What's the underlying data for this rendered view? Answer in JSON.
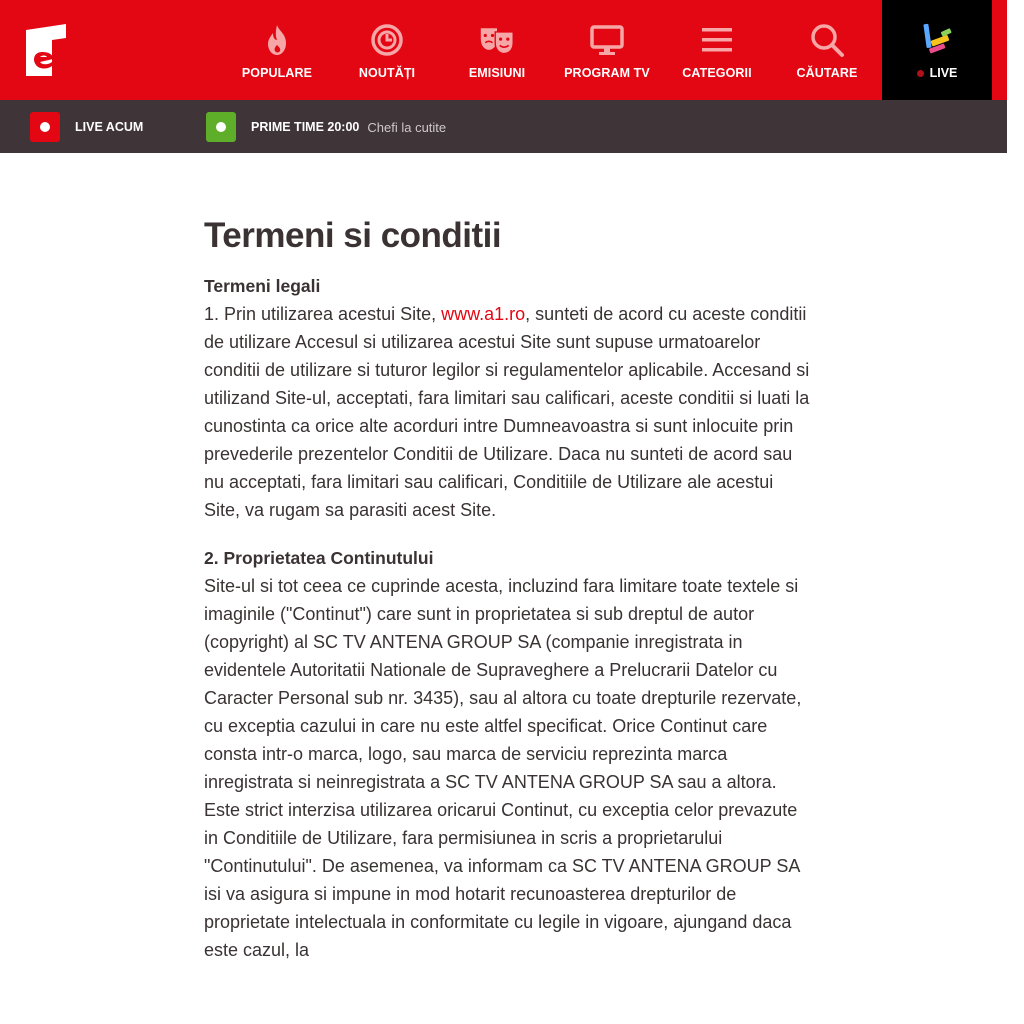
{
  "header": {
    "logo_label": "Antena 1 logo",
    "nav": [
      {
        "label": "POPULARE",
        "icon": "flame-icon"
      },
      {
        "label": "NOUTĂȚI",
        "icon": "clock-icon"
      },
      {
        "label": "EMISIUNI",
        "icon": "theater-masks-icon"
      },
      {
        "label": "PROGRAM TV",
        "icon": "tv-monitor-icon"
      },
      {
        "label": "CATEGORII",
        "icon": "menu-lines-icon"
      },
      {
        "label": "CĂUTARE",
        "icon": "search-icon"
      }
    ],
    "live_label": "LIVE",
    "live_icon": "antena-play-icon"
  },
  "subbar": {
    "live_now_label": "LIVE ACUM",
    "prime_time_label": "PRIME TIME 20:00",
    "prime_time_show": "Chefi la cutite"
  },
  "main": {
    "title": "Termeni si conditii",
    "section1_heading": "Termeni legali",
    "section1_text_before_link": "1. Prin utilizarea acestui Site, ",
    "section1_link": "www.a1.ro",
    "section1_text_after_link": ", sunteti de acord cu aceste conditii de utilizare Accesul si utilizarea acestui Site sunt supuse urmatoarelor conditii de utilizare si tuturor legilor si regulamentelor aplicabile. Accesand si utilizand Site-ul, acceptati, fara limitari sau calificari, aceste conditii si luati la cunostinta ca orice alte acorduri intre Dumneavoastra si sunt inlocuite prin prevederile prezentelor Conditii de Utilizare. Daca nu sunteti de acord sau nu acceptati, fara limitari sau calificari, Conditiile de Utilizare ale acestui Site, va rugam sa parasiti acest Site.",
    "section2_heading": "2. Proprietatea Continutului",
    "section2_text": "Site-ul si tot ceea ce cuprinde acesta, incluzind fara limitare toate textele si imaginile (\"Continut\") care sunt in proprietatea si sub dreptul de autor (copyright) al SC TV ANTENA GROUP SA (companie inregistrata in evidentele Autoritatii Nationale de Supraveghere a Prelucrarii Datelor cu Caracter Personal sub nr. 3435), sau al altora cu toate drepturile rezervate, cu exceptia cazului in care nu este altfel specificat. Orice Continut care consta intr-o marca, logo, sau marca de serviciu reprezinta marca inregistrata si neinregistrata a SC TV ANTENA GROUP SA sau a altora. Este strict interzisa utilizarea oricarui Continut, cu exceptia celor prevazute in Conditiile de Utilizare, fara permisiunea in scris a proprietarului \"Continutului\". De asemenea, va informam ca SC TV ANTENA GROUP SA isi va asigura si impune in mod hotarit recunoasterea drepturilor de proprietate intelectuala in conformitate cu legile in vigoare, ajungand daca este cazul, la"
  },
  "colors": {
    "brand_red": "#e30613",
    "subbar_bg": "#3f3437",
    "live_bg": "#000000",
    "green_square": "#5fae2a"
  }
}
